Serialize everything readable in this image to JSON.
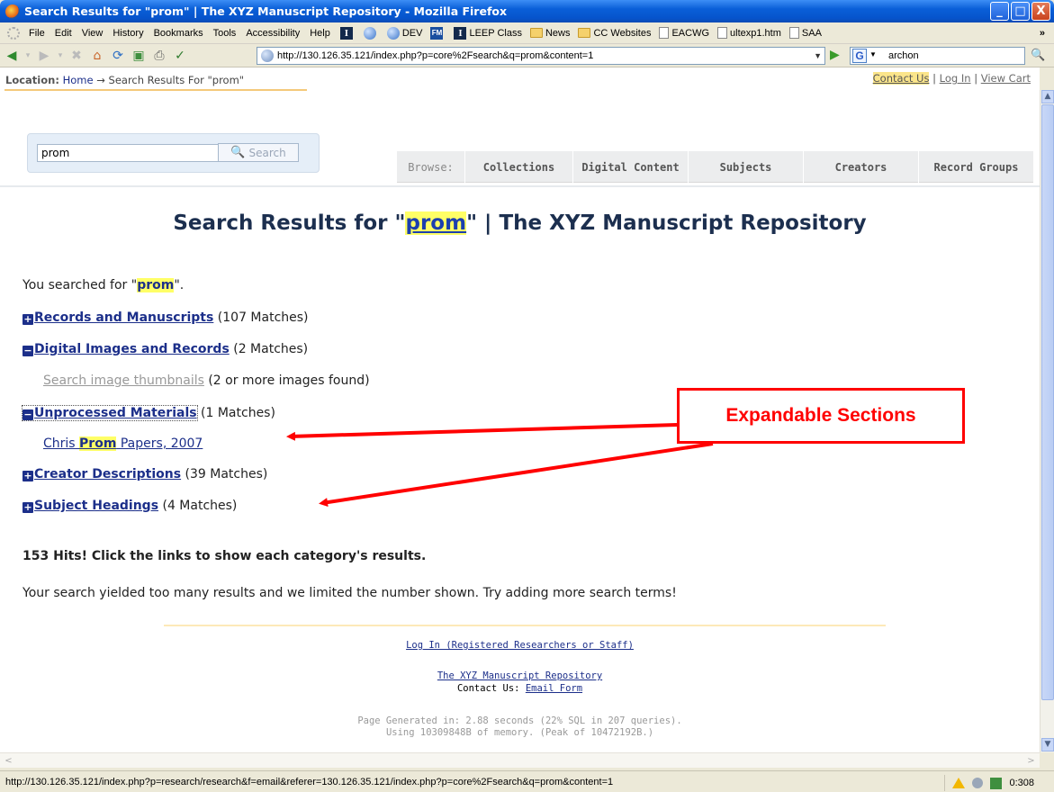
{
  "window": {
    "title": "Search Results for \"prom\" | The XYZ Manuscript Repository - Mozilla Firefox",
    "controls": {
      "minimize": "_",
      "maximize": "□",
      "close": "X"
    }
  },
  "menu": {
    "items": [
      "File",
      "Edit",
      "View",
      "History",
      "Bookmarks",
      "Tools",
      "Accessibility",
      "Help"
    ],
    "bookmarks": [
      "DEV",
      "LEEP Class",
      "News",
      "CC Websites",
      "EACWG",
      "ultexp1.htm",
      "SAA"
    ],
    "overflow": "»"
  },
  "navbar": {
    "url": "http://130.126.35.121/index.php?p=core%2Fsearch&q=prom&content=1",
    "search_engine_value": "archon"
  },
  "page": {
    "location_label": "Location:",
    "location_home": "Home",
    "location_arrow": "→",
    "location_current": "Search Results For \"prom\"",
    "contact_us": "Contact Us",
    "log_in": "Log In",
    "view_cart": "View Cart",
    "link_sep": "|",
    "search_value": "prom",
    "search_button": "Search",
    "tabs": [
      "Browse:",
      "Collections",
      "Digital Content",
      "Subjects",
      "Creators",
      "Record Groups"
    ],
    "heading_prefix": "Search Results for \"",
    "heading_term": "prom",
    "heading_suffix": "\" | The XYZ Manuscript Repository",
    "searched_prefix": "You searched for \"",
    "searched_term": "prom",
    "searched_suffix": "\".",
    "sections": [
      {
        "toggle": "+",
        "label": "Records and Manuscripts",
        "count": "(107 Matches)"
      },
      {
        "toggle": "−",
        "label": "Digital Images and Records",
        "count": "(2 Matches)"
      },
      {
        "toggle": "−",
        "label": "Unprocessed Materials",
        "count": "(1 Matches)"
      },
      {
        "toggle": "+",
        "label": "Creator Descriptions",
        "count": "(39 Matches)"
      },
      {
        "toggle": "+",
        "label": "Subject Headings",
        "count": "(4 Matches)"
      }
    ],
    "thumbnails_link": "Search image thumbnails",
    "thumbnails_note": "(2 or more images found)",
    "result_prefix": "Chris ",
    "result_term": "Prom",
    "result_suffix": " Papers, 2007",
    "hits": "153 Hits! Click the links to show each category's results.",
    "limit_note": "Your search yielded too many results and we limited the number shown. Try adding more search terms!",
    "annotation": "Expandable Sections",
    "footer_login": "Log In (Registered Researchers or Staff)",
    "footer_repo": "The XYZ Manuscript Repository",
    "footer_contact_label": "Contact Us:",
    "footer_contact_link": "Email Form",
    "footer_generated": "Page Generated in: 2.88 seconds (22% SQL in 207 queries).",
    "footer_memory": "Using 10309848B of memory. (Peak of 10472192B.)"
  },
  "status": {
    "url": "http://130.126.35.121/index.php?p=research/research&f=email&referer=130.126.35.121/index.php?p=core%2Fsearch&q=prom&content=1",
    "counter": "0:308"
  }
}
